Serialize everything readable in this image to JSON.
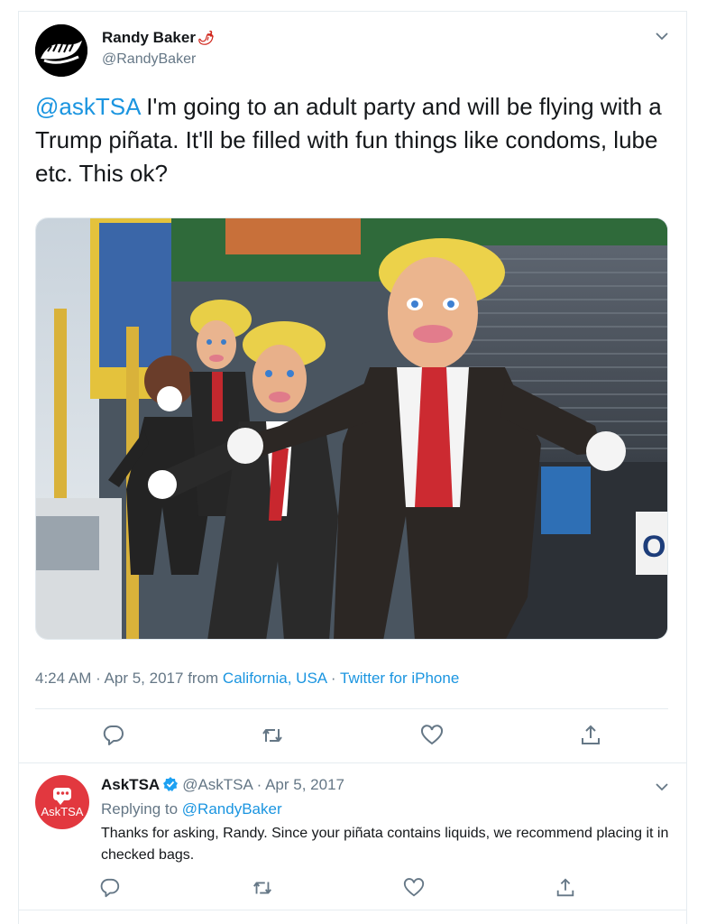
{
  "tweet": {
    "author_name": "Randy Baker",
    "author_emoji": "🌶",
    "author_handle": "@RandyBaker",
    "mention": "@askTSA",
    "text": " I'm going to an adult party and will be flying with a Trump piñata. It'll be filled with fun things like condoms, lube etc. This ok?",
    "time": "4:24 AM",
    "date": "Apr 5, 2017",
    "from_label": "from",
    "location": "California, USA",
    "source": "Twitter for iPhone",
    "photo_icon": "pinata-photo"
  },
  "reply": {
    "author_name": "AskTSA",
    "author_handle": "@AskTSA",
    "date": "Apr 5, 2017",
    "avatar_label": "AskTSA",
    "replying_label": "Replying to",
    "replying_handle": "@RandyBaker",
    "text": "Thanks for asking, Randy. Since your piñata contains liquids, we recommend placing it in checked bags."
  },
  "actions": [
    "reply-icon",
    "retweet-icon",
    "like-icon",
    "share-icon"
  ],
  "colors": {
    "link": "#1b95e0",
    "muted": "#657786",
    "tsa_red": "#e2383f"
  }
}
